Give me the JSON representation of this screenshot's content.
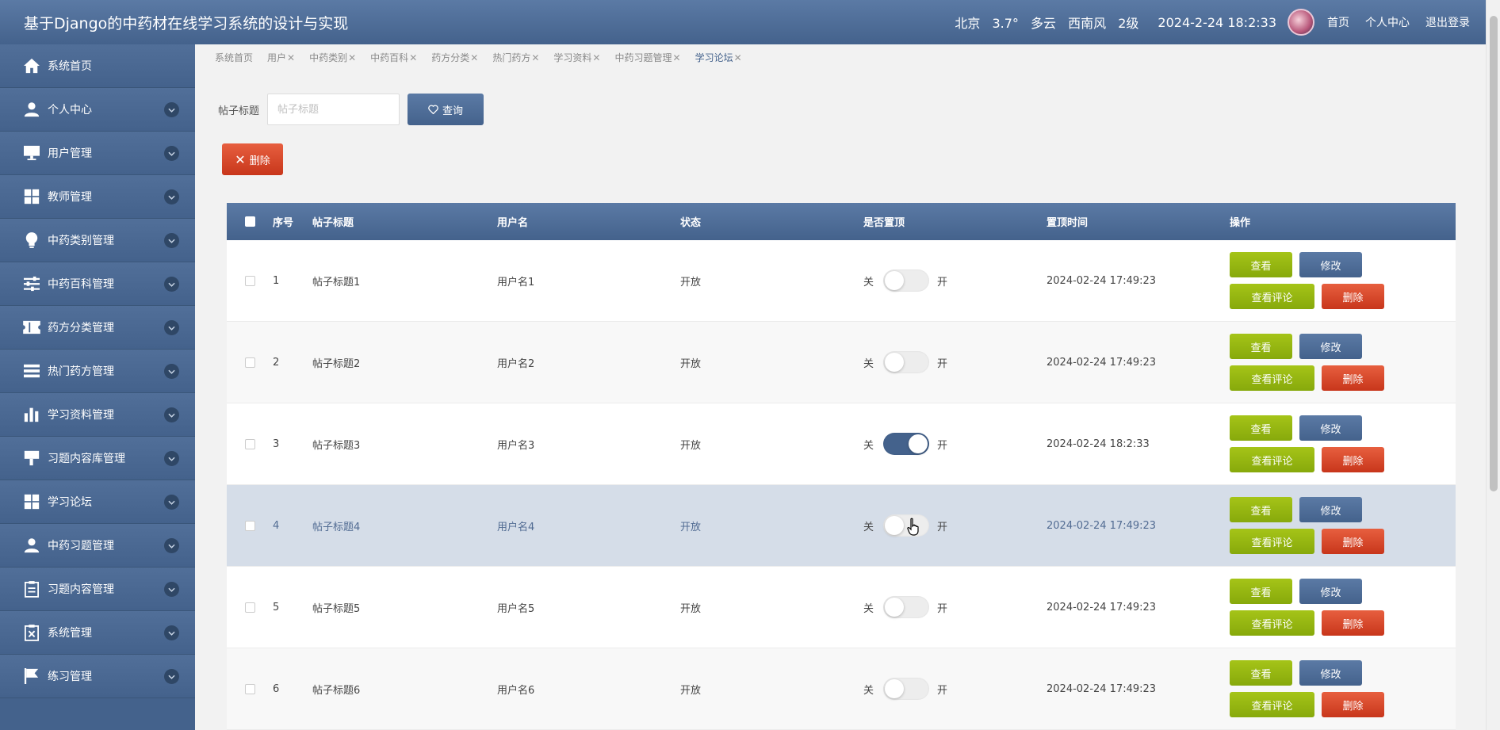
{
  "header": {
    "title": "基于Django的中药材在线学习系统的设计与实现",
    "weather": {
      "city": "北京",
      "temp": "3.7°",
      "condition": "多云",
      "wind": "西南风",
      "level": "2级"
    },
    "datetime": "2024-2-24 18:2:33",
    "links": {
      "home": "首页",
      "profile": "个人中心",
      "logout": "退出登录"
    }
  },
  "sidebar": {
    "items": [
      {
        "label": "系统首页",
        "icon": "home-icon",
        "expandable": false
      },
      {
        "label": "个人中心",
        "icon": "user-icon",
        "expandable": true
      },
      {
        "label": "用户管理",
        "icon": "monitor-icon",
        "expandable": true
      },
      {
        "label": "教师管理",
        "icon": "grid-icon",
        "expandable": true
      },
      {
        "label": "中药类别管理",
        "icon": "bulb-icon",
        "expandable": true
      },
      {
        "label": "中药百科管理",
        "icon": "sliders-icon",
        "expandable": true
      },
      {
        "label": "药方分类管理",
        "icon": "ticket-icon",
        "expandable": true
      },
      {
        "label": "热门药方管理",
        "icon": "list-icon",
        "expandable": true
      },
      {
        "label": "学习资料管理",
        "icon": "bar-chart-icon",
        "expandable": true
      },
      {
        "label": "习题内容库管理",
        "icon": "sign-icon",
        "expandable": true
      },
      {
        "label": "学习论坛",
        "icon": "grid-icon",
        "expandable": true
      },
      {
        "label": "中药习题管理",
        "icon": "user-icon",
        "expandable": true
      },
      {
        "label": "习题内容管理",
        "icon": "clipboard-icon",
        "expandable": true
      },
      {
        "label": "系统管理",
        "icon": "file-x-icon",
        "expandable": true
      },
      {
        "label": "练习管理",
        "icon": "flag-icon",
        "expandable": true
      }
    ]
  },
  "tabs": [
    {
      "label": "系统首页",
      "closable": false
    },
    {
      "label": "用户",
      "closable": true
    },
    {
      "label": "中药类别",
      "closable": true
    },
    {
      "label": "中药百科",
      "closable": true
    },
    {
      "label": "药方分类",
      "closable": true
    },
    {
      "label": "热门药方",
      "closable": true
    },
    {
      "label": "学习资料",
      "closable": true
    },
    {
      "label": "中药习题管理",
      "closable": true
    },
    {
      "label": "学习论坛",
      "closable": true,
      "active": true
    }
  ],
  "search": {
    "label": "帖子标题",
    "placeholder": "帖子标题",
    "value": "",
    "button": "查询"
  },
  "toolbar": {
    "delete_label": "删除"
  },
  "table": {
    "headers": {
      "index": "序号",
      "title": "帖子标题",
      "username": "用户名",
      "status": "状态",
      "pinned": "是否置顶",
      "pin_time": "置顶时间",
      "ops": "操作"
    },
    "switch_off": "关",
    "switch_on": "开",
    "ops": {
      "view": "查看",
      "edit": "修改",
      "comments": "查看评论",
      "delete": "删除"
    },
    "rows": [
      {
        "index": "1",
        "title": "帖子标题1",
        "username": "用户名1",
        "status": "开放",
        "pinned": false,
        "pin_time": "2024-02-24 17:49:23"
      },
      {
        "index": "2",
        "title": "帖子标题2",
        "username": "用户名2",
        "status": "开放",
        "pinned": false,
        "pin_time": "2024-02-24 17:49:23"
      },
      {
        "index": "3",
        "title": "帖子标题3",
        "username": "用户名3",
        "status": "开放",
        "pinned": true,
        "pin_time": "2024-02-24 18:2:33"
      },
      {
        "index": "4",
        "title": "帖子标题4",
        "username": "用户名4",
        "status": "开放",
        "pinned": false,
        "pin_time": "2024-02-24 17:49:23"
      },
      {
        "index": "5",
        "title": "帖子标题5",
        "username": "用户名5",
        "status": "开放",
        "pinned": false,
        "pin_time": "2024-02-24 17:49:23"
      },
      {
        "index": "6",
        "title": "帖子标题6",
        "username": "用户名6",
        "status": "开放",
        "pinned": false,
        "pin_time": "2024-02-24 17:49:23"
      }
    ]
  },
  "colors": {
    "primary": "#44628c",
    "success": "#93b411",
    "danger": "#d9482a"
  }
}
